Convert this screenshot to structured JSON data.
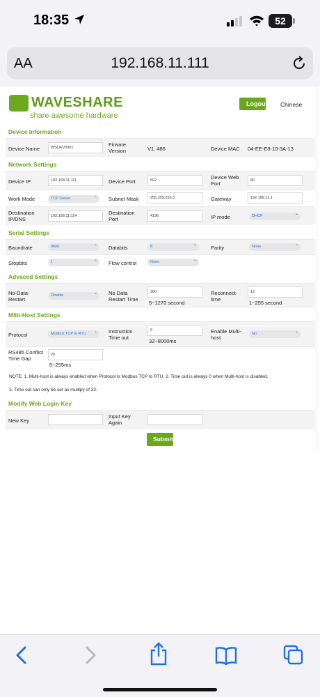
{
  "status_bar": {
    "time": "18:35",
    "battery": "52"
  },
  "address_bar": {
    "text_size_label": "AA",
    "url": "192.168.11.111"
  },
  "header": {
    "logo_name": "WAVESHARE",
    "logo_tagline": "share awesome hardware",
    "logout_label": "Logout",
    "language_label": "Chinese"
  },
  "device_info": {
    "title": "Device Information",
    "device_name_label": "Device Name",
    "device_name_value": "WSDEV0001",
    "firmware_label": "Firware Version",
    "firmware_value": "V1. 486",
    "mac_label": "Device MAC",
    "mac_value": "04-EE-E8-10-3A-13"
  },
  "network": {
    "title": "Network Settings",
    "device_ip_label": "Device IP",
    "device_ip_value": "192.168.11.111",
    "device_port_label": "Device Port",
    "device_port_value": "502",
    "web_port_label": "Device Web Port",
    "web_port_value": "80",
    "work_mode_label": "Work Mode",
    "work_mode_value": "TCP Server",
    "subnet_label": "Subnet Mask",
    "subnet_value": "255.255.255.0",
    "gateway_label": "Gateway",
    "gateway_value": "192.168.11.1",
    "dest_ip_label": "Destination IP/DNS",
    "dest_ip_value": "192.168.11.114",
    "dest_port_label": "Destination Port",
    "dest_port_value": "4196",
    "ip_mode_label": "IP mode",
    "ip_mode_value": "DHCP"
  },
  "serial": {
    "title": "Serial Settings",
    "baud_label": "Baundrate",
    "baud_value": "9600",
    "databits_label": "Databits",
    "databits_value": "8",
    "parity_label": "Parity",
    "parity_value": "None",
    "stopbits_label": "Stopbits",
    "stopbits_value": "1",
    "flow_label": "Flow control",
    "flow_value": "None"
  },
  "advanced": {
    "title": "Advaced Settings",
    "no_data_restart_label": "No-Data-Restart",
    "no_data_restart_value": "Disable",
    "restart_time_label": "No Data Restart Time",
    "restart_time_value": "300",
    "restart_time_hint": "5~1270 second",
    "reconnect_label": "Reconnect-time",
    "reconnect_value": "12",
    "reconnect_hint": "1~255 second"
  },
  "multihost": {
    "title": "Mliti-Host Settings",
    "protocol_label": "Protocol",
    "protocol_value": "Modbus TCP to RTU",
    "timeout_label": "Instruction Time out",
    "timeout_value": "0",
    "timeout_hint": "32~8000ms",
    "enable_label": "Enable Multi-host",
    "enable_value": "No",
    "gap_label": "RS485 Conflict Time Gap",
    "gap_value": "20",
    "gap_hint": "5~255ms",
    "note_line1": "NOTE: 1. Multi-host is always enabled when Protocol is Modbus TCP to RTU. 2. Time out is always 0 when Multi-host is disabled.",
    "note_line2": "3. Time out can only be set as mulitpy of 32."
  },
  "login_key": {
    "title": "Modify Web Login Key",
    "new_key_label": "New Key",
    "new_key_value": "",
    "input_again_label": "Input Key Again",
    "input_again_value": ""
  },
  "submit_label": "Submit",
  "colors": {
    "brand_green": "#6aa71c",
    "ios_blue": "#1f6fe5"
  }
}
